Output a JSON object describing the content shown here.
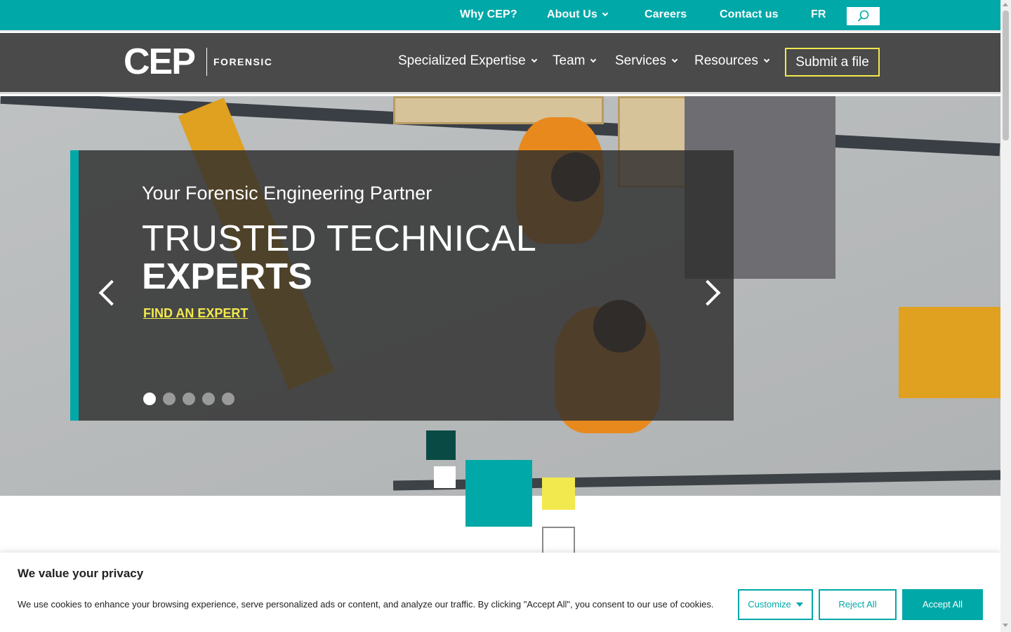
{
  "topbar": {
    "items": [
      {
        "label": "Why CEP?"
      },
      {
        "label": "About Us"
      },
      {
        "label": "Careers"
      },
      {
        "label": "Contact us"
      },
      {
        "label": "FR"
      }
    ],
    "search_icon": "search-icon",
    "background": "#00a8a8"
  },
  "mainnav": {
    "logo_text": "CEP",
    "logo_sub": "FORENSIC",
    "items": [
      {
        "label": "Specialized Expertise"
      },
      {
        "label": "Team"
      },
      {
        "label": "Services"
      },
      {
        "label": "Resources"
      }
    ],
    "submit_label": "Submit a file",
    "background": "#4a4a4a",
    "accent": "#f2e94e"
  },
  "hero": {
    "subtitle": "Your Forensic Engineering Partner",
    "title_line1": "TRUSTED TECHNICAL",
    "title_line2": "EXPERTS",
    "cta": "FIND AN EXPERT",
    "prev_icon": "chevron-left-icon",
    "next_icon": "chevron-right-icon",
    "slide_count": 5,
    "active_slide": 1
  },
  "cookie": {
    "title": "We value your privacy",
    "text": "We use cookies to enhance your browsing experience, serve personalized ads or content, and analyze our traffic. By clicking \"Accept All\", you consent to our use of cookies.",
    "customize": "Customize",
    "reject": "Reject All",
    "accept": "Accept All"
  },
  "colors": {
    "teal": "#00a8a8",
    "dark_teal": "#0a4a44",
    "yellow": "#f2e94e"
  }
}
